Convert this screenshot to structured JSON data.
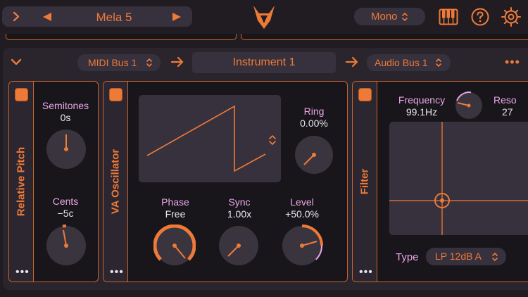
{
  "header": {
    "preset_name": "Mela 5",
    "mode_label": "Mono",
    "expand_icon": "chevron-right-icon",
    "prev_icon": "triangle-left-icon",
    "next_icon": "triangle-right-icon",
    "logo_icon": "fox-logo-icon",
    "keyboard_icon": "piano-keyboard-icon",
    "help_icon": "question-mark-icon",
    "settings_icon": "gear-icon"
  },
  "routing": {
    "midi_bus": "MIDI Bus 1",
    "instrument": "Instrument 1",
    "audio_bus": "Audio Bus 1"
  },
  "modules": {
    "relative_pitch": {
      "title": "Relative Pitch",
      "semitones": {
        "name": "Semitones",
        "value": "0s",
        "level": 0.5
      },
      "cents": {
        "name": "Cents",
        "value": "−5c",
        "level": 0.45
      }
    },
    "va_oscillator": {
      "title": "VA Oscillator",
      "waveform": "sawtooth",
      "ring": {
        "name": "Ring",
        "value": "0.00%",
        "level": 0.0
      },
      "phase": {
        "name": "Phase",
        "value": "Free",
        "level": 1.0
      },
      "sync": {
        "name": "Sync",
        "value": "1.00x",
        "level": 0.0
      },
      "level": {
        "name": "Level",
        "value": "+50.0%",
        "level": 0.75
      }
    },
    "filter": {
      "title": "Filter",
      "frequency": {
        "name": "Frequency",
        "value": "99.1Hz"
      },
      "resonance": {
        "name": "Reso",
        "value": "27"
      },
      "type_label": "Type",
      "type_value": "LP 12dB A"
    }
  },
  "colors": {
    "accent": "#ee7a38",
    "label": "#e9a6e8",
    "background": "#201c22",
    "panel": "#19161b"
  }
}
